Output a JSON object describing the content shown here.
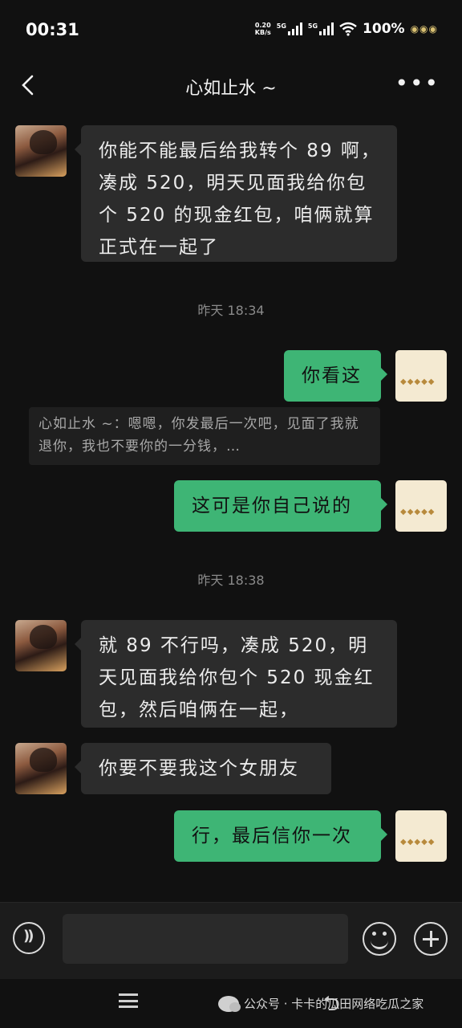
{
  "status_bar": {
    "time": "00:31",
    "net_speed_value": "0.20",
    "net_speed_unit": "KB/s",
    "signal1": "5G",
    "signal2": "5G",
    "battery": "100%"
  },
  "header": {
    "title": "心如止水 ~"
  },
  "messages": [
    {
      "side": "in",
      "text": "你能不能最后给我转个 89 啊，凑成 520，明天见面我给你包个 520 的现金红包，咱俩就算正式在一起了"
    },
    {
      "timestamp": "昨天 18:34"
    },
    {
      "side": "out",
      "text": "你看这"
    },
    {
      "quote": "心如止水 ~：嗯嗯，你发最后一次吧，见面了我就退你，我也不要你的一分钱，…"
    },
    {
      "side": "out",
      "text": "这可是你自己说的"
    },
    {
      "timestamp": "昨天 18:38"
    },
    {
      "side": "in",
      "text": "就 89 不行吗，凑成 520，明天见面我给你包个 520 现金红包，然后咱俩在一起，"
    },
    {
      "side": "in",
      "text": "你要不要我这个女朋友"
    },
    {
      "side": "out",
      "text": "行，最后信你一次"
    }
  ],
  "watermark": {
    "text": "公众号 · 卡卡的瓜田网络吃瓜之家"
  },
  "colors": {
    "background": "#111111",
    "incoming_bubble": "#2c2c2c",
    "outgoing_bubble": "#3eb575"
  }
}
